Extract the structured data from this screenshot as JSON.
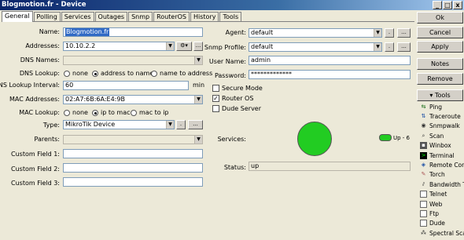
{
  "window": {
    "title": "Blogmotion.fr - Device",
    "min": "_",
    "max": "□",
    "close": "x"
  },
  "tabs": [
    "General",
    "Polling",
    "Services",
    "Outages",
    "Snmp",
    "RouterOS",
    "History",
    "Tools"
  ],
  "left": {
    "name_label": "Name:",
    "name_value": "Blogmotion.fr",
    "addresses_label": "Addresses:",
    "addresses_value": "10.10.2.2",
    "dns_names_label": "DNS Names:",
    "dns_lookup_label": "DNS Lookup:",
    "dns_opts": [
      "none",
      "address to name",
      "name to address"
    ],
    "dns_interval_label": "DNS Lookup Interval:",
    "dns_interval_value": "60",
    "dns_interval_unit": "min",
    "mac_label": "MAC Addresses:",
    "mac_value": "02:A7:6B:6A:E4:9B",
    "mac_lookup_label": "MAC Lookup:",
    "mac_opts": [
      "none",
      "ip to mac",
      "mac to ip"
    ],
    "type_label": "Type:",
    "type_value": "MikroTik Device",
    "parents_label": "Parents:",
    "cf1_label": "Custom Field 1:",
    "cf2_label": "Custom Field 2:",
    "cf3_label": "Custom Field 3:"
  },
  "right": {
    "agent_label": "Agent:",
    "agent_value": "default",
    "snmp_label": "Snmp Profile:",
    "snmp_value": "default",
    "user_label": "User Name:",
    "user_value": "admin",
    "pass_label": "Password:",
    "pass_value": "*************",
    "secure_mode": "Secure Mode",
    "router_os": "Router OS",
    "dude_server": "Dude Server",
    "services_label": "Services:",
    "services_badge": "Up - 6",
    "status_label": "Status:",
    "status_value": "up"
  },
  "buttons": {
    "ok": "Ok",
    "cancel": "Cancel",
    "apply": "Apply",
    "notes": "Notes",
    "remove": "Remove",
    "tools": "▾ Tools",
    "dots": "...",
    "dot": "."
  },
  "tools": [
    {
      "label": "Ping",
      "icon": "ping-icon"
    },
    {
      "label": "Traceroute",
      "icon": "traceroute-icon"
    },
    {
      "label": "Snmpwalk",
      "icon": "snmpwalk-icon"
    },
    {
      "label": "Scan",
      "icon": "scan-icon"
    },
    {
      "label": "Winbox",
      "icon": "winbox-icon"
    },
    {
      "label": "Terminal",
      "icon": "terminal-icon"
    },
    {
      "label": "Remote Conn",
      "icon": "remote-icon"
    },
    {
      "label": "Torch",
      "icon": "torch-icon"
    },
    {
      "label": "Bandwidth Te",
      "icon": "bandwidth-icon"
    },
    {
      "label": "Telnet",
      "icon": "telnet-icon"
    },
    {
      "label": "Web",
      "icon": "web-icon"
    },
    {
      "label": "Ftp",
      "icon": "ftp-icon"
    },
    {
      "label": "Dude",
      "icon": "dude-icon"
    },
    {
      "label": "Spectral Scan",
      "icon": "spectral-icon"
    }
  ]
}
